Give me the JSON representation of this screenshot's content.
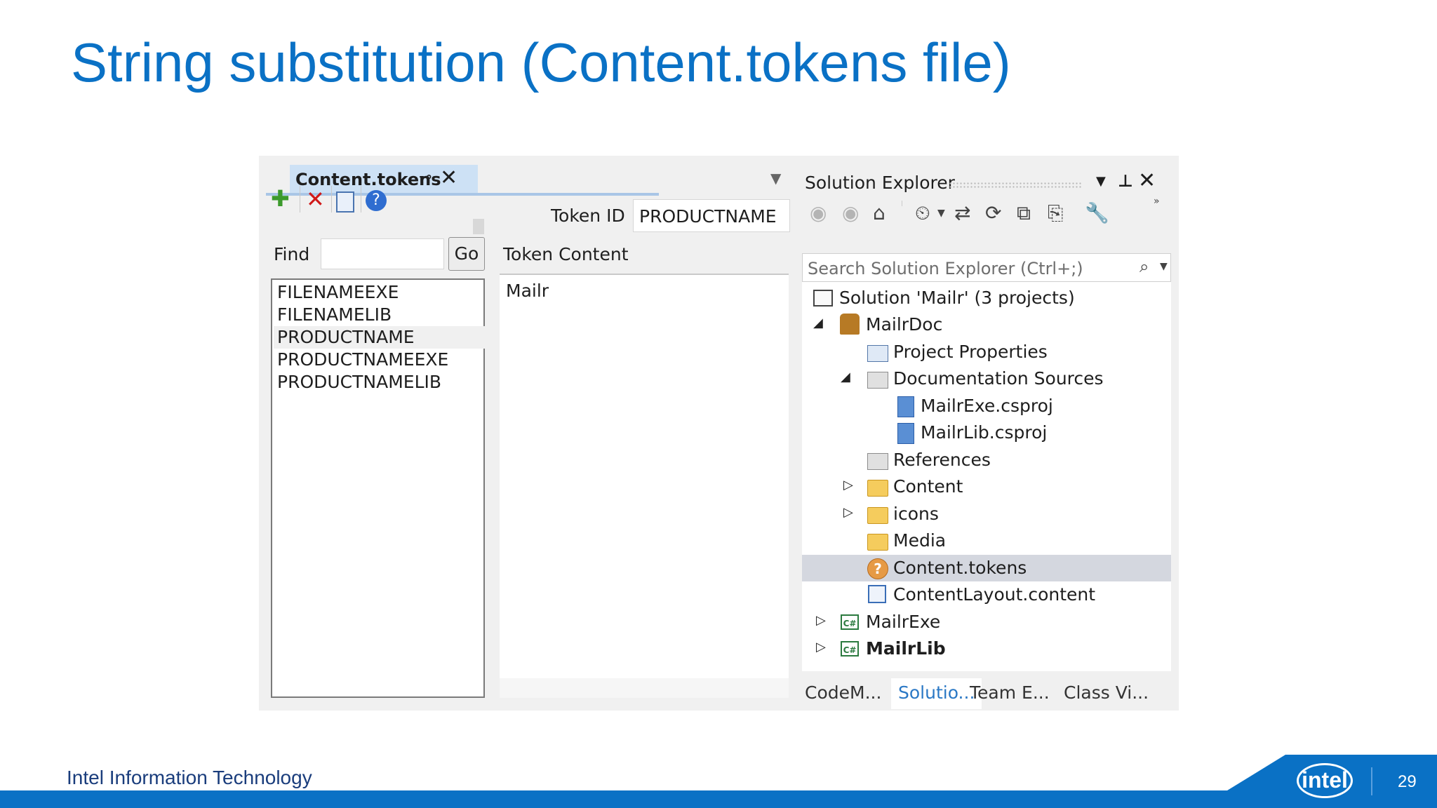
{
  "slide": {
    "title": "String substitution (Content.tokens file)",
    "footer": "Intel Information Technology",
    "page_number": "29",
    "logo_text": "intel",
    "colors": {
      "accent": "#0a71c5",
      "selected_row": "#d4d7df",
      "tab_active": "#cde1f5"
    }
  },
  "editor": {
    "tab_label": "Content.tokens",
    "pin_icon": "pin-icon",
    "close_icon": "close-icon",
    "toolbar_icons": [
      "add-token-icon",
      "delete-token-icon",
      "copy-icon",
      "help-icon"
    ],
    "find_label": "Find",
    "find_value": "",
    "go_label": "Go",
    "token_id_label": "Token ID",
    "token_id_value": "PRODUCTNAME",
    "token_content_label": "Token Content",
    "token_content_value": "Mailr",
    "tokens": [
      "FILENAMEEXE",
      "FILENAMELIB",
      "PRODUCTNAME",
      "PRODUCTNAMEEXE",
      "PRODUCTNAMELIB"
    ],
    "selected_token": "PRODUCTNAME"
  },
  "solution_explorer": {
    "title": "Solution Explorer",
    "search_placeholder": "Search Solution Explorer (Ctrl+;)",
    "tree": {
      "solution": "Solution 'Mailr' (3 projects)",
      "mailrdoc": "MailrDoc",
      "project_properties": "Project Properties",
      "documentation_sources": "Documentation Sources",
      "mailrexe_csproj": "MailrExe.csproj",
      "mailrlib_csproj": "MailrLib.csproj",
      "references": "References",
      "content": "Content",
      "icons": "icons",
      "media": "Media",
      "content_tokens": "Content.tokens",
      "content_layout": "ContentLayout.content",
      "mailrexe": "MailrExe",
      "mailrlib": "MailrLib"
    },
    "bottom_tabs": [
      "CodeM...",
      "Solutio...",
      "Team E...",
      "Class Vi..."
    ],
    "active_bottom_tab": "Solutio..."
  }
}
